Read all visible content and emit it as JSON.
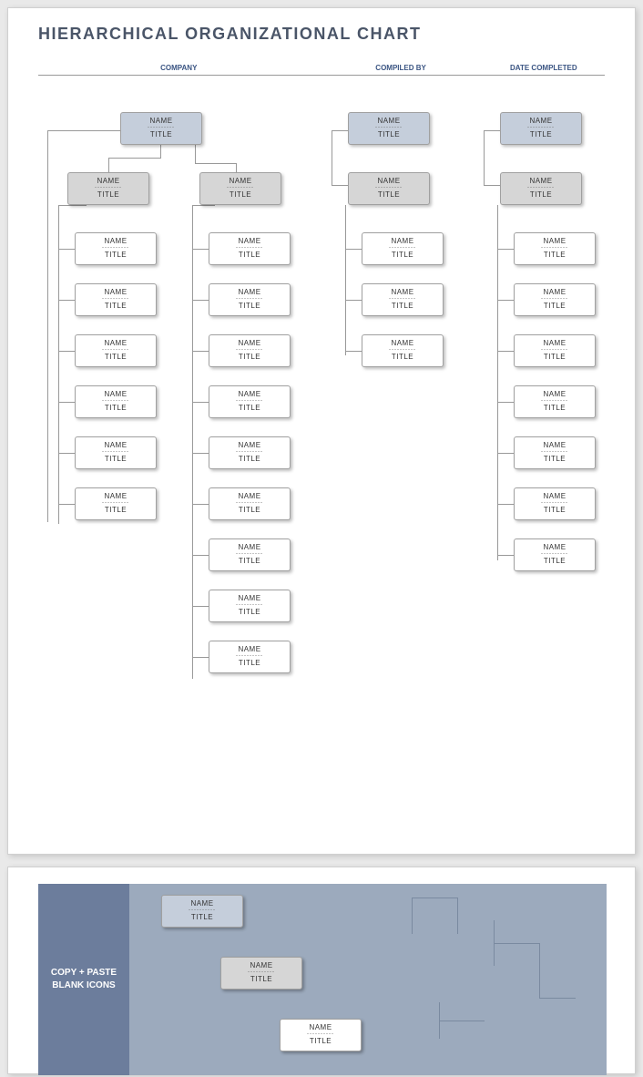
{
  "title": "HIERARCHICAL ORGANIZATIONAL CHART",
  "headers": {
    "company": "COMPANY",
    "compiled_by": "COMPILED BY",
    "date_completed": "DATE COMPLETED"
  },
  "placeholder": {
    "name": "NAME",
    "dash": "----------",
    "title": "TITLE"
  },
  "section1": {
    "top_blue": {
      "name": "NAME",
      "title": "TITLE"
    },
    "mgr_left": {
      "name": "NAME",
      "title": "TITLE"
    },
    "mgr_right": {
      "name": "NAME",
      "title": "TITLE"
    },
    "left_children": [
      {
        "name": "NAME",
        "title": "TITLE"
      },
      {
        "name": "NAME",
        "title": "TITLE"
      },
      {
        "name": "NAME",
        "title": "TITLE"
      },
      {
        "name": "NAME",
        "title": "TITLE"
      },
      {
        "name": "NAME",
        "title": "TITLE"
      },
      {
        "name": "NAME",
        "title": "TITLE"
      }
    ],
    "right_children": [
      {
        "name": "NAME",
        "title": "TITLE"
      },
      {
        "name": "NAME",
        "title": "TITLE"
      },
      {
        "name": "NAME",
        "title": "TITLE"
      },
      {
        "name": "NAME",
        "title": "TITLE"
      },
      {
        "name": "NAME",
        "title": "TITLE"
      },
      {
        "name": "NAME",
        "title": "TITLE"
      },
      {
        "name": "NAME",
        "title": "TITLE"
      },
      {
        "name": "NAME",
        "title": "TITLE"
      },
      {
        "name": "NAME",
        "title": "TITLE"
      }
    ]
  },
  "section2": {
    "top_blue": {
      "name": "NAME",
      "title": "TITLE"
    },
    "mgr": {
      "name": "NAME",
      "title": "TITLE"
    },
    "children": [
      {
        "name": "NAME",
        "title": "TITLE"
      },
      {
        "name": "NAME",
        "title": "TITLE"
      },
      {
        "name": "NAME",
        "title": "TITLE"
      }
    ]
  },
  "section3": {
    "top_blue": {
      "name": "NAME",
      "title": "TITLE"
    },
    "mgr": {
      "name": "NAME",
      "title": "TITLE"
    },
    "children": [
      {
        "name": "NAME",
        "title": "TITLE"
      },
      {
        "name": "NAME",
        "title": "TITLE"
      },
      {
        "name": "NAME",
        "title": "TITLE"
      },
      {
        "name": "NAME",
        "title": "TITLE"
      },
      {
        "name": "NAME",
        "title": "TITLE"
      },
      {
        "name": "NAME",
        "title": "TITLE"
      },
      {
        "name": "NAME",
        "title": "TITLE"
      }
    ]
  },
  "copy_paste_label": "COPY + PASTE BLANK ICONS",
  "copy_paste_nodes": {
    "blue": {
      "name": "NAME",
      "title": "TITLE"
    },
    "grey": {
      "name": "NAME",
      "title": "TITLE"
    },
    "white": {
      "name": "NAME",
      "title": "TITLE"
    }
  }
}
